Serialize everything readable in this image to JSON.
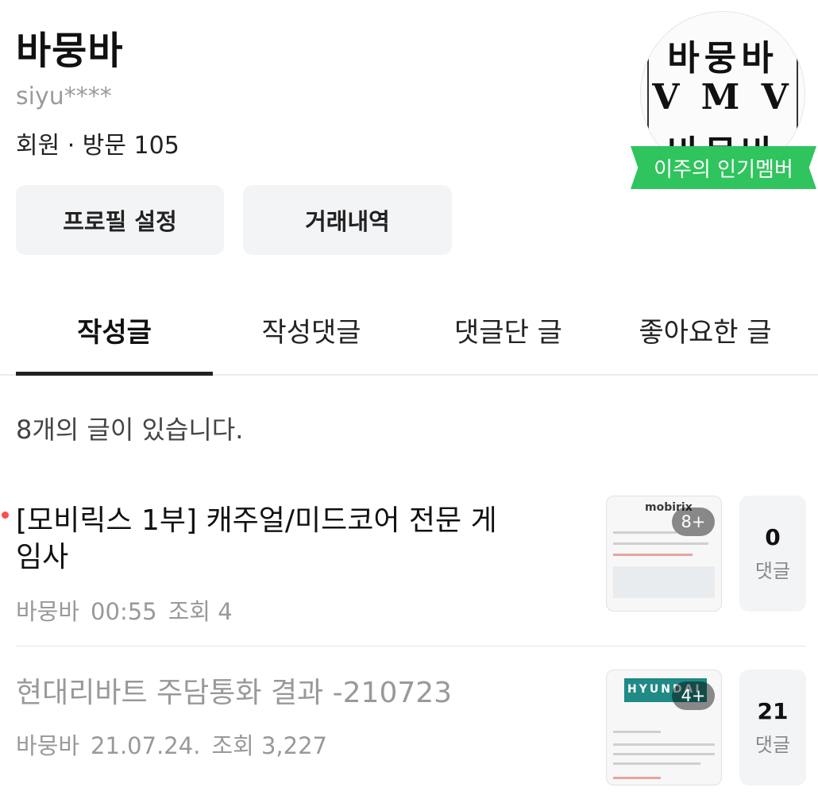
{
  "profile": {
    "name": "바뭉바",
    "user_id": "siyu****",
    "meta": "회원 · 방문 105",
    "avatar_rows": [
      "바뭉바",
      "V M V",
      "바뭉바"
    ],
    "badge": "이주의 인기멤버"
  },
  "buttons": {
    "profile_settings": "프로필 설정",
    "transaction_history": "거래내역"
  },
  "tabs": [
    {
      "label": "작성글",
      "active": true
    },
    {
      "label": "작성댓글",
      "active": false
    },
    {
      "label": "댓글단 글",
      "active": false
    },
    {
      "label": "좋아요한 글",
      "active": false
    }
  ],
  "post_count_text": "8개의 글이 있습니다.",
  "posts": [
    {
      "title": "[모비릭스 1부] 캐주얼/미드코어 전문 게임사",
      "author": "바뭉바",
      "time": "00:55",
      "views": "조회 4",
      "image_count": "8+",
      "thumb_logo": "mobirix",
      "comments": "0",
      "comment_label": "댓글",
      "unread": true
    },
    {
      "title": "현대리바트 주담통화 결과 -210723",
      "author": "바뭉바",
      "time": "21.07.24.",
      "views": "조회 3,227",
      "image_count": "4+",
      "thumb_logo": "HYUNDAI",
      "comments": "21",
      "comment_label": "댓글",
      "unread": false
    }
  ],
  "colors": {
    "badge_green": "#2fc45d",
    "unread_dot": "#ff4d4d",
    "button_bg": "#f3f4f6"
  }
}
